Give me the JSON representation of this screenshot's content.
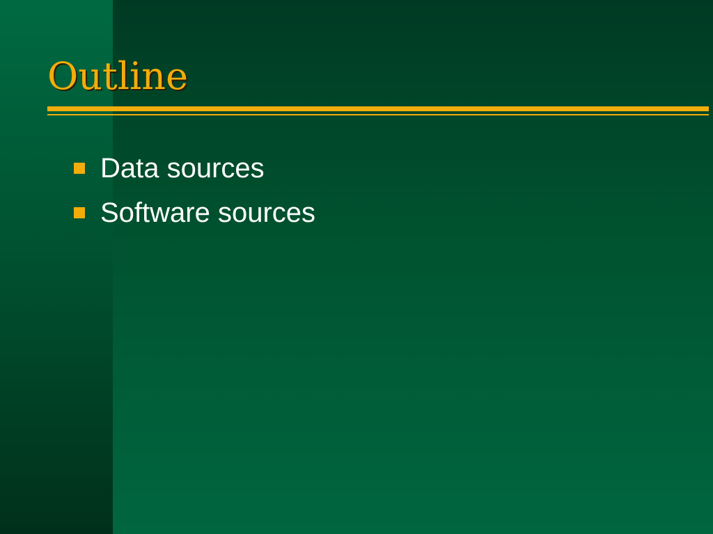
{
  "slide": {
    "title": "Outline",
    "bullets": [
      {
        "text": "Data sources"
      },
      {
        "text": "Software sources"
      }
    ]
  },
  "colors": {
    "accent": "#f2ad0c",
    "background": "#00532f",
    "text": "#ffffff"
  }
}
